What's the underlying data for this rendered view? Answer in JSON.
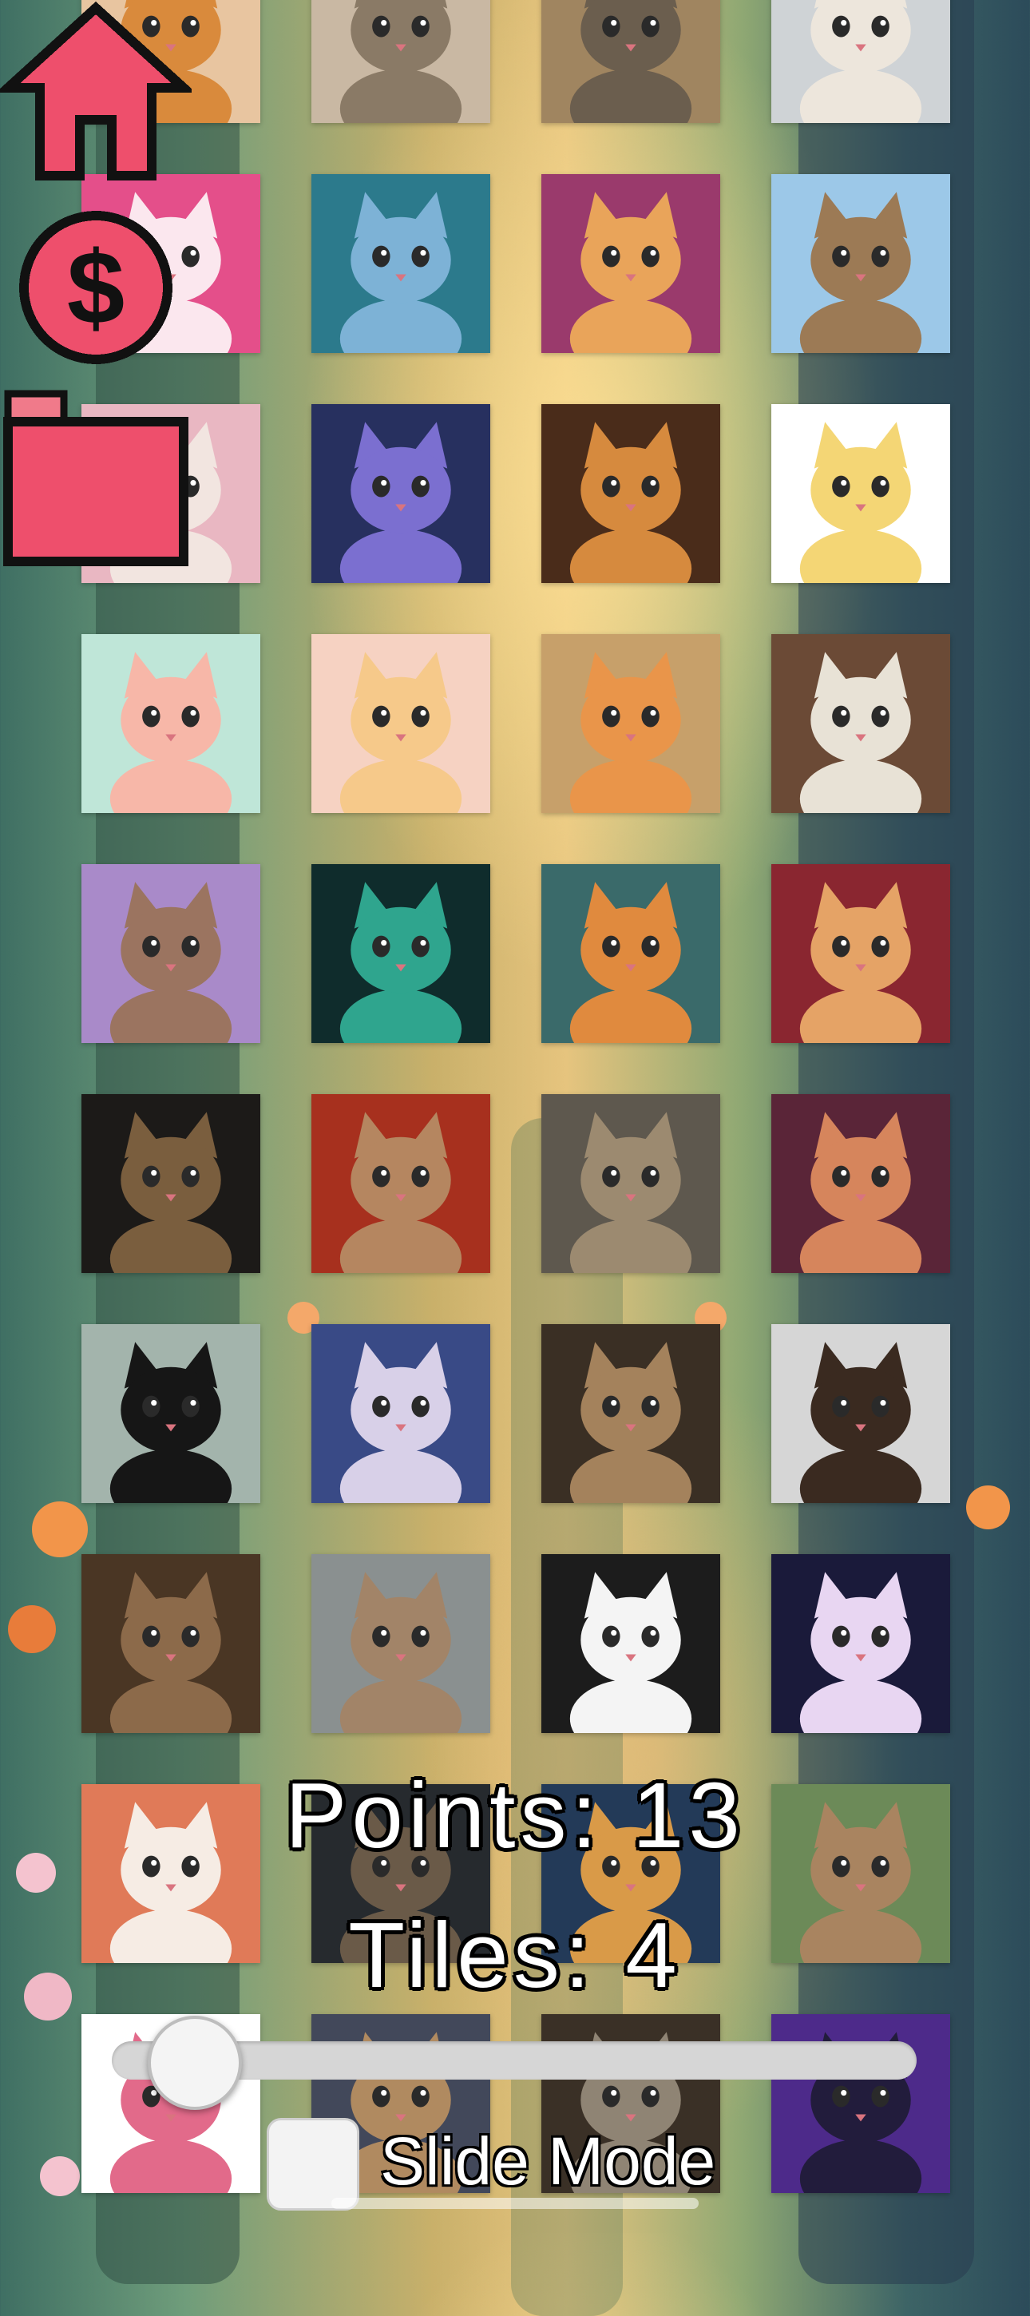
{
  "hud": {
    "points_label": "Points: 13",
    "tiles_label": "Tiles: 4"
  },
  "controls": {
    "slider_value": 0.05,
    "slide_mode_label": "Slide Mode",
    "slide_mode_checked": false
  },
  "sidebar": {
    "home_icon": "home-icon",
    "coin_icon": "dollar-coin-icon",
    "folder_icon": "folder-icon",
    "accent": "#ee4f6c"
  },
  "tiles": [
    {
      "name": "tile-orange-cat",
      "bg": "#e8c5a0",
      "fur": "#d98a3c"
    },
    {
      "name": "tile-cat-in-bed",
      "bg": "#c9b8a3",
      "fur": "#8a7a66"
    },
    {
      "name": "tile-cat-rubiks-cube",
      "bg": "#a08560",
      "fur": "#6b5e4e"
    },
    {
      "name": "tile-cat-laptop",
      "bg": "#cfd3d6",
      "fur": "#ede6dc"
    },
    {
      "name": "tile-pink-anime-cat",
      "bg": "#e44f8a",
      "fur": "#fbe7ee"
    },
    {
      "name": "tile-forest-blue-cat",
      "bg": "#2c7a8c",
      "fur": "#7db2d6"
    },
    {
      "name": "tile-pixel-cat-couch",
      "bg": "#9a3a6c",
      "fur": "#e9a45a"
    },
    {
      "name": "tile-pixel-cat-grass",
      "bg": "#9cc8e8",
      "fur": "#9c7a55"
    },
    {
      "name": "tile-cat-donut",
      "bg": "#e9b7c2",
      "fur": "#f2e5e0"
    },
    {
      "name": "tile-galaxy-cat",
      "bg": "#27305f",
      "fur": "#7b6fd0"
    },
    {
      "name": "tile-cat-library",
      "bg": "#4a2c1a",
      "fur": "#d68a3e"
    },
    {
      "name": "tile-melon-cat",
      "bg": "#ffffff",
      "fur": "#f4d675"
    },
    {
      "name": "tile-watermelon-cat",
      "bg": "#bfe6d8",
      "fur": "#f7b7a8"
    },
    {
      "name": "tile-peach-cat",
      "bg": "#f6d2c2",
      "fur": "#f6c98a"
    },
    {
      "name": "tile-fruit-market-cat",
      "bg": "#c7a06a",
      "fur": "#e9954a"
    },
    {
      "name": "tile-cafe-cats",
      "bg": "#6b4a36",
      "fur": "#e8e2d6"
    },
    {
      "name": "tile-pastel-tabby",
      "bg": "#a98ac9",
      "fur": "#9b7460"
    },
    {
      "name": "tile-matrix-cat",
      "bg": "#0f2c2c",
      "fur": "#2fa58e"
    },
    {
      "name": "tile-jungle-cat",
      "bg": "#3a6a6a",
      "fur": "#e08a3e"
    },
    {
      "name": "tile-burger-cat",
      "bg": "#8a2630",
      "fur": "#e5a366"
    },
    {
      "name": "tile-wizard-cat",
      "bg": "#1c1a18",
      "fur": "#7a5e3e"
    },
    {
      "name": "tile-cat-red-wall",
      "bg": "#a7301e",
      "fur": "#b58660"
    },
    {
      "name": "tile-flower-crown-cat",
      "bg": "#5e584e",
      "fur": "#9c8a70"
    },
    {
      "name": "tile-neon-cat",
      "bg": "#5a2538",
      "fur": "#d6855c"
    },
    {
      "name": "tile-black-cat",
      "bg": "#a3b4ac",
      "fur": "#161616"
    },
    {
      "name": "tile-sunglasses-cat",
      "bg": "#394a86",
      "fur": "#d8d0e8"
    },
    {
      "name": "tile-round-brown-cat",
      "bg": "#3a2f24",
      "fur": "#a4825c"
    },
    {
      "name": "tile-calico-cat",
      "bg": "#d6d6d6",
      "fur": "#3a2a20"
    },
    {
      "name": "tile-fluffy-tabby",
      "bg": "#4a3624",
      "fur": "#8c6a4a"
    },
    {
      "name": "tile-window-cat",
      "bg": "#8a9090",
      "fur": "#a28468"
    },
    {
      "name": "tile-tuxedo-cat",
      "bg": "#1c1c1c",
      "fur": "#f4f4f4"
    },
    {
      "name": "tile-rainbow-light-cat",
      "bg": "#1a1a3a",
      "fur": "#e8d6f2"
    },
    {
      "name": "tile-white-fluffy-cat",
      "bg": "#e07a58",
      "fur": "#f6ece4"
    },
    {
      "name": "tile-dark-tabby",
      "bg": "#262a2e",
      "fur": "#6a5a48"
    },
    {
      "name": "tile-golden-cat",
      "bg": "#233a58",
      "fur": "#d99a48"
    },
    {
      "name": "tile-cute-tabby",
      "bg": "#6c8a58",
      "fur": "#a98460"
    },
    {
      "name": "tile-paint-splash-cat",
      "bg": "#ffffff",
      "fur": "#e26a8a"
    },
    {
      "name": "tile-tabby-lookup",
      "bg": "#42485a",
      "fur": "#b08a60"
    },
    {
      "name": "tile-grey-tabby",
      "bg": "#3a3026",
      "fur": "#8f8474"
    },
    {
      "name": "tile-purple-jungle-cat",
      "bg": "#4d2a8a",
      "fur": "#221c3c"
    }
  ]
}
